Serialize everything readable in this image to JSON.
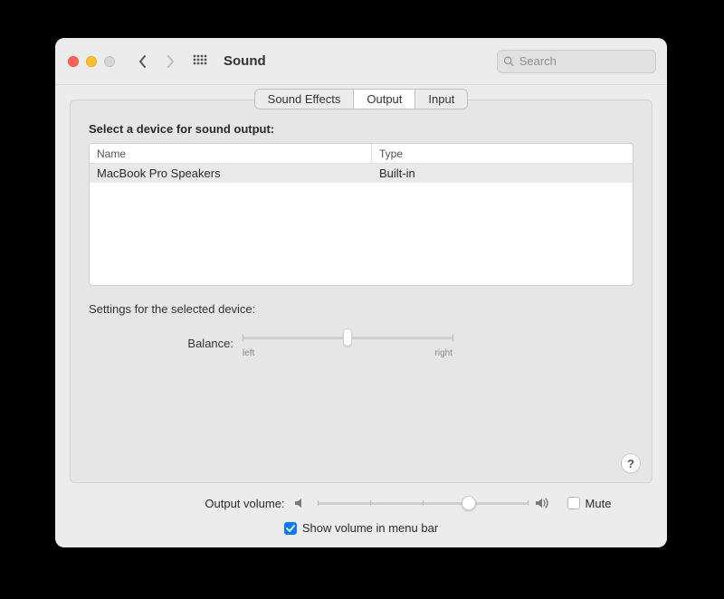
{
  "window": {
    "title": "Sound"
  },
  "search": {
    "placeholder": "Search"
  },
  "tabs": {
    "effects": "Sound Effects",
    "output": "Output",
    "input": "Input",
    "active": "output"
  },
  "section": {
    "select_label": "Select a device for sound output:",
    "col_name": "Name",
    "col_type": "Type"
  },
  "devices": [
    {
      "name": "MacBook Pro Speakers",
      "type": "Built-in"
    }
  ],
  "settings": {
    "heading": "Settings for the selected device:",
    "balance_label": "Balance:",
    "balance_left": "left",
    "balance_right": "right",
    "balance_value": 50
  },
  "help_label": "?",
  "volume": {
    "label": "Output volume:",
    "value": 72,
    "mute_label": "Mute",
    "mute_checked": false
  },
  "menubar": {
    "label": "Show volume in menu bar",
    "checked": true
  }
}
